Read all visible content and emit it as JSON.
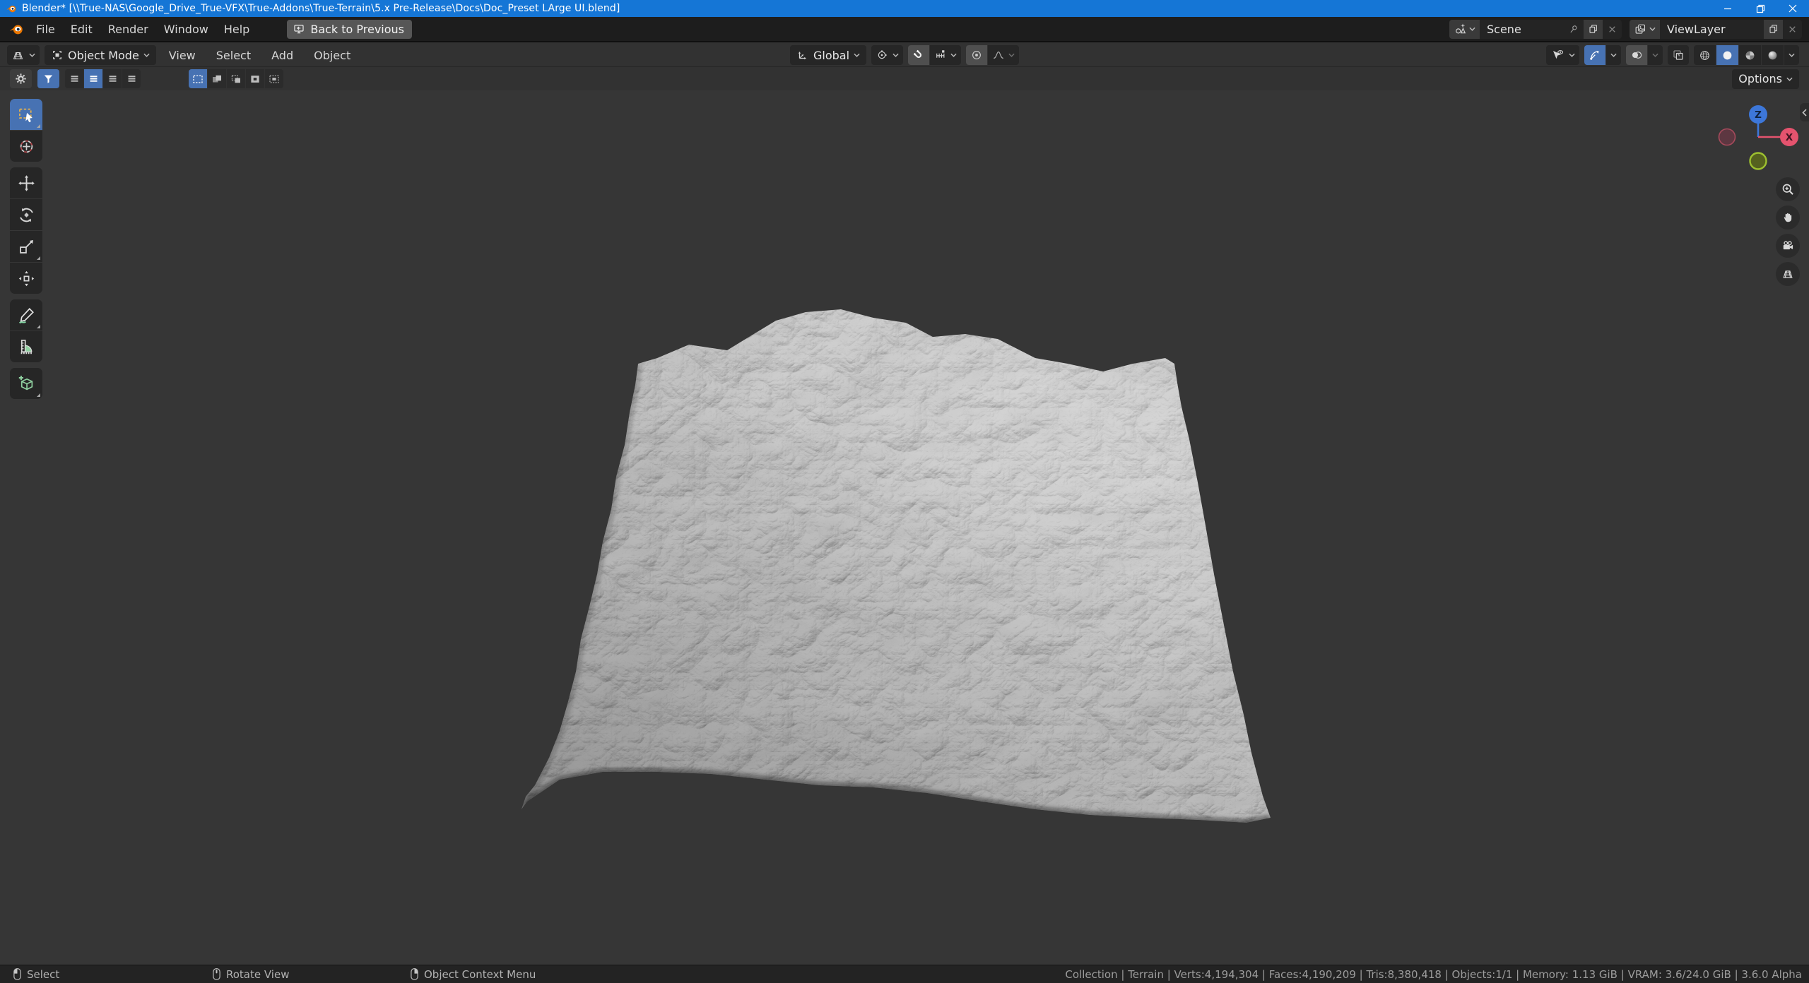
{
  "window": {
    "title": "Blender* [\\\\True-NAS\\Google_Drive_True-VFX\\True-Addons\\True-Terrain\\5.x Pre-Release\\Docs\\Doc_Preset LArge UI.blend]"
  },
  "topbar": {
    "menus": [
      "File",
      "Edit",
      "Render",
      "Window",
      "Help"
    ],
    "back_button": "Back to Previous",
    "scene_selector": {
      "value": "Scene"
    },
    "view_layer_selector": {
      "value": "ViewLayer"
    }
  },
  "header": {
    "mode_selector": "Object Mode",
    "menus": [
      "View",
      "Select",
      "Add",
      "Object"
    ],
    "orientation": "Global",
    "options": "Options"
  },
  "viewport": {
    "gizmo": {
      "z_label": "Z",
      "x_label": "X"
    }
  },
  "statusbar": {
    "hints": [
      {
        "mouse": "left",
        "label": "Select"
      },
      {
        "mouse": "middle",
        "label": "Rotate View"
      },
      {
        "mouse": "right",
        "label": "Object Context Menu"
      }
    ],
    "stats": "Collection | Terrain | Verts:4,194,304 | Faces:4,190,209 | Tris:8,380,418 | Objects:1/1 | Memory: 1.13 GiB | VRAM: 3.6/24.0 GiB | 3.6.0 Alpha"
  },
  "colors": {
    "accent_active": "#4772b3",
    "titlebar": "#1576d6",
    "axis_x": "#e5536e",
    "axis_y": "#9dc02f",
    "axis_z": "#3d77d9"
  }
}
